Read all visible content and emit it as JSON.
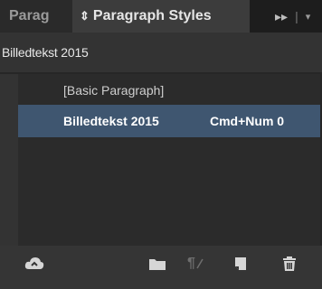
{
  "tabs": {
    "inactive_label": "Parag",
    "active_label": "Paragraph Styles",
    "updown_glyph": "⇕",
    "forward_glyph": "▸▸",
    "separator_glyph": "|",
    "menu_glyph": "▾"
  },
  "current_style": "Billedtekst 2015",
  "styles": [
    {
      "name": "[Basic Paragraph]",
      "shortcut": ""
    },
    {
      "name": "Billedtekst 2015",
      "shortcut": "Cmd+Num 0",
      "selected": true
    }
  ],
  "toolbar": {
    "icons": [
      "cloud-icon",
      "folder-icon",
      "pilcrow-override-icon",
      "new-style-icon",
      "trash-icon"
    ],
    "pilcrow_glyph": "¶"
  },
  "colors": {
    "panel_bg": "#333333",
    "list_bg": "#2b2b2b",
    "selection": "#3f5670",
    "tabbar_bg": "#1d1d1d"
  }
}
